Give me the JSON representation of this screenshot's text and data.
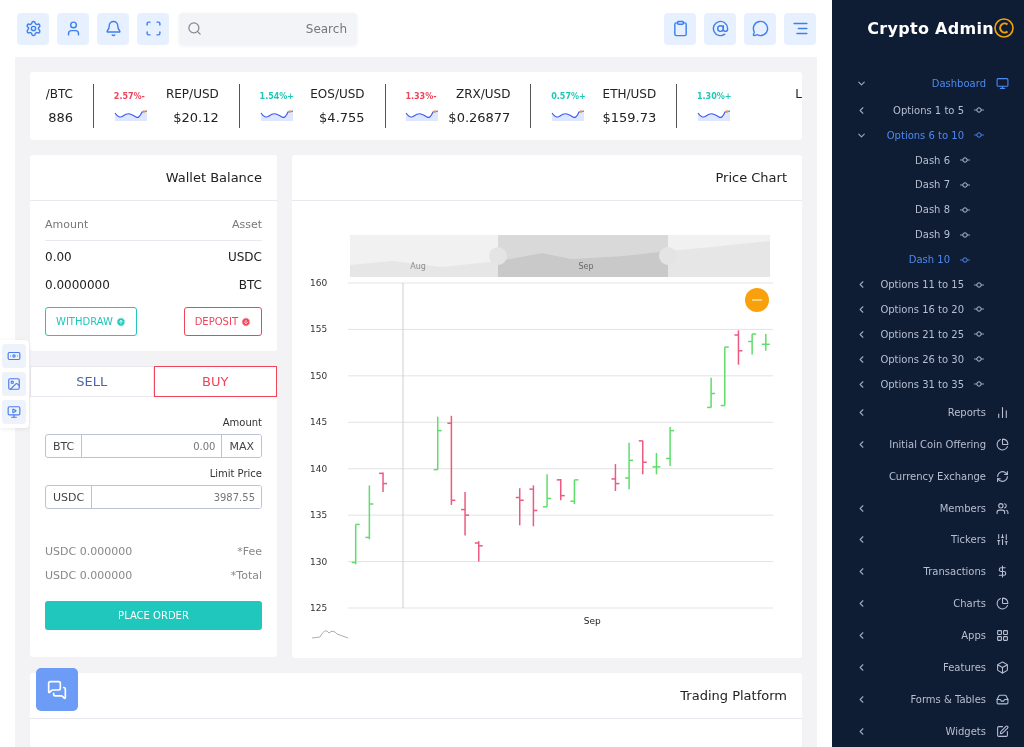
{
  "toolbar": {
    "search": {
      "placeholder": "Search"
    }
  },
  "tickers": [
    {
      "pair": "/BTC",
      "price": "886"
    },
    {
      "change": "2.57%-",
      "color": "#f0445a",
      "pair": "REP/USD",
      "price": "$20.12"
    },
    {
      "change": "1.54%+",
      "color": "#1fc7b6",
      "pair": "EOS/USD",
      "price": "$4.755"
    },
    {
      "change": "1.33%-",
      "color": "#f0445a",
      "pair": "ZRX/USD",
      "price": "$0.26877"
    },
    {
      "change": "0.57%+",
      "color": "#1fc7b6",
      "pair": "ETH/USD",
      "price": "$159.73"
    },
    {
      "change": "1.30%+",
      "color": "#1fc7b6",
      "pair": "L"
    }
  ],
  "wallet": {
    "title": "Wallet Balance",
    "columns": [
      "Amount",
      "Asset"
    ],
    "rows": [
      [
        "0.00",
        "USDC"
      ],
      [
        "0.0000000",
        "BTC"
      ]
    ],
    "buttons": [
      {
        "kind": "withdraw",
        "label": "WITHDRAW"
      },
      {
        "kind": "deposit",
        "label": "DEPOSIT"
      }
    ]
  },
  "trade": {
    "tabs": [
      {
        "label": "SELL",
        "selected": false
      },
      {
        "label": "BUY",
        "selected": true
      }
    ],
    "amount": {
      "label": "Amount",
      "unit": "BTC",
      "value": "0.00",
      "action": "MAX"
    },
    "limit": {
      "label": "Limit Price",
      "unit": "USDC",
      "value": "3987.55"
    },
    "fees": [
      {
        "value": "USDC 0.000000",
        "label": "*Fee"
      },
      {
        "value": "USDC 0.000000",
        "label": "*Total"
      }
    ],
    "submit": "PLACE ORDER"
  },
  "price_chart": {
    "title": "Price Chart",
    "navigator": [
      "Aug",
      "Sep"
    ],
    "y_labels": [
      "160",
      "155",
      "150",
      "145",
      "140",
      "135",
      "130",
      "125"
    ],
    "x_labels": [
      "Sep"
    ]
  },
  "trading_platform": {
    "title": "Trading Platform"
  },
  "sidebar": {
    "brand": "Crypto Admin",
    "items": [
      {
        "kind": "group",
        "label": "Dashboard",
        "expanded": true,
        "selected": true,
        "children": [
          {
            "kind": "group",
            "label": "Options 1 to 5",
            "expanded": false,
            "selected": false
          },
          {
            "kind": "group",
            "label": "Options 6 to 10",
            "expanded": true,
            "selected": true,
            "children": [
              {
                "label": "Dash 6",
                "selected": false
              },
              {
                "label": "Dash 7",
                "selected": false
              },
              {
                "label": "Dash 8",
                "selected": false
              },
              {
                "label": "Dash 9",
                "selected": false
              },
              {
                "label": "Dash 10",
                "selected": true
              }
            ]
          },
          {
            "kind": "group",
            "label": "Options 11 to 15",
            "expanded": false,
            "selected": false
          },
          {
            "kind": "group",
            "label": "Options 16 to 20",
            "expanded": false,
            "selected": false
          },
          {
            "kind": "group",
            "label": "Options 21 to 25",
            "expanded": false,
            "selected": false
          },
          {
            "kind": "group",
            "label": "Options 26 to 30",
            "expanded": false,
            "selected": false
          },
          {
            "kind": "group",
            "label": "Options 31 to 35",
            "expanded": false,
            "selected": false
          }
        ]
      },
      {
        "kind": "group",
        "label": "Reports",
        "expanded": false,
        "selected": false
      },
      {
        "kind": "group",
        "label": "Initial Coin Offering",
        "expanded": false,
        "selected": false
      },
      {
        "kind": "link",
        "label": "Currency Exchange",
        "selected": false
      },
      {
        "kind": "group",
        "label": "Members",
        "expanded": false,
        "selected": false
      },
      {
        "kind": "group",
        "label": "Tickers",
        "expanded": false,
        "selected": false
      },
      {
        "kind": "group",
        "label": "Transactions",
        "expanded": false,
        "selected": false
      },
      {
        "kind": "group",
        "label": "Charts",
        "expanded": false,
        "selected": false
      },
      {
        "kind": "group",
        "label": "Apps",
        "expanded": false,
        "selected": false
      },
      {
        "kind": "group",
        "label": "Features",
        "expanded": false,
        "selected": false
      },
      {
        "kind": "group",
        "label": "Forms & Tables",
        "expanded": false,
        "selected": false
      },
      {
        "kind": "group",
        "label": "Widgets",
        "expanded": false,
        "selected": false
      }
    ]
  }
}
